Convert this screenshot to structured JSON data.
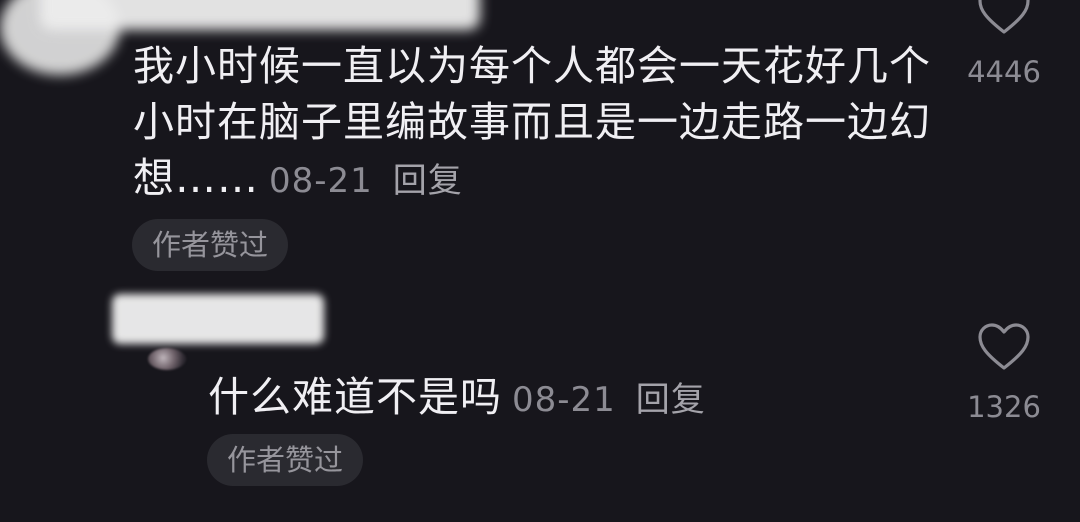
{
  "comments": [
    {
      "text": "我小时候一直以为每个人都会一天花好几个小时在脑子里编故事而且是一边走路一边幻想……",
      "date": "08-21",
      "reply_label": "回复",
      "author_liked_label": "作者赞过",
      "like_count": "4446",
      "like_icon": "heart-outline-icon"
    },
    {
      "text": "什么难道不是吗",
      "date": "08-21",
      "reply_label": "回复",
      "author_liked_label": "作者赞过",
      "like_count": "1326",
      "like_icon": "heart-outline-icon"
    }
  ],
  "colors": {
    "background": "#17161c",
    "text": "#f0eff3",
    "meta": "#8c8b93",
    "pill_bg": "#2a2a30"
  }
}
